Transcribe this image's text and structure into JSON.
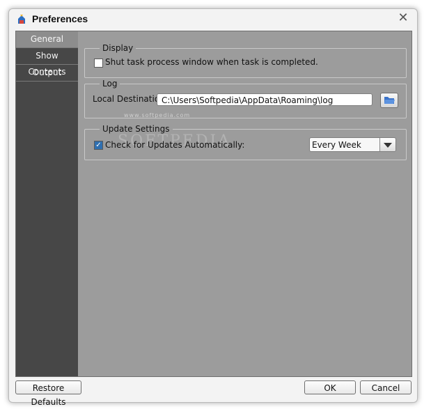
{
  "window": {
    "title": "Preferences",
    "app_icon": "app-icon",
    "close_icon": "close-icon"
  },
  "sidebar": {
    "items": [
      {
        "label": "General",
        "active": true
      },
      {
        "label": "Show Contents",
        "active": false
      },
      {
        "label": "Output",
        "active": false
      }
    ]
  },
  "display": {
    "title": "Display",
    "shut_label": "Shut task process window when task is completed.",
    "shut_checked": false
  },
  "log": {
    "title": "Log",
    "dest_label": "Local Destination:",
    "dest_value": "C:\\Users\\Softpedia\\AppData\\Roaming\\log",
    "folder_icon": "folder-icon"
  },
  "watermark": {
    "big": "SOFTPEDIA",
    "small": "www.softpedia.com"
  },
  "updates": {
    "title": "Update Settings",
    "check_label": "Check for Updates Automatically:",
    "check_checked": true,
    "frequency": "Every Week"
  },
  "footer": {
    "restore_label": "Restore Defaults",
    "ok_label": "OK",
    "cancel_label": "Cancel"
  }
}
